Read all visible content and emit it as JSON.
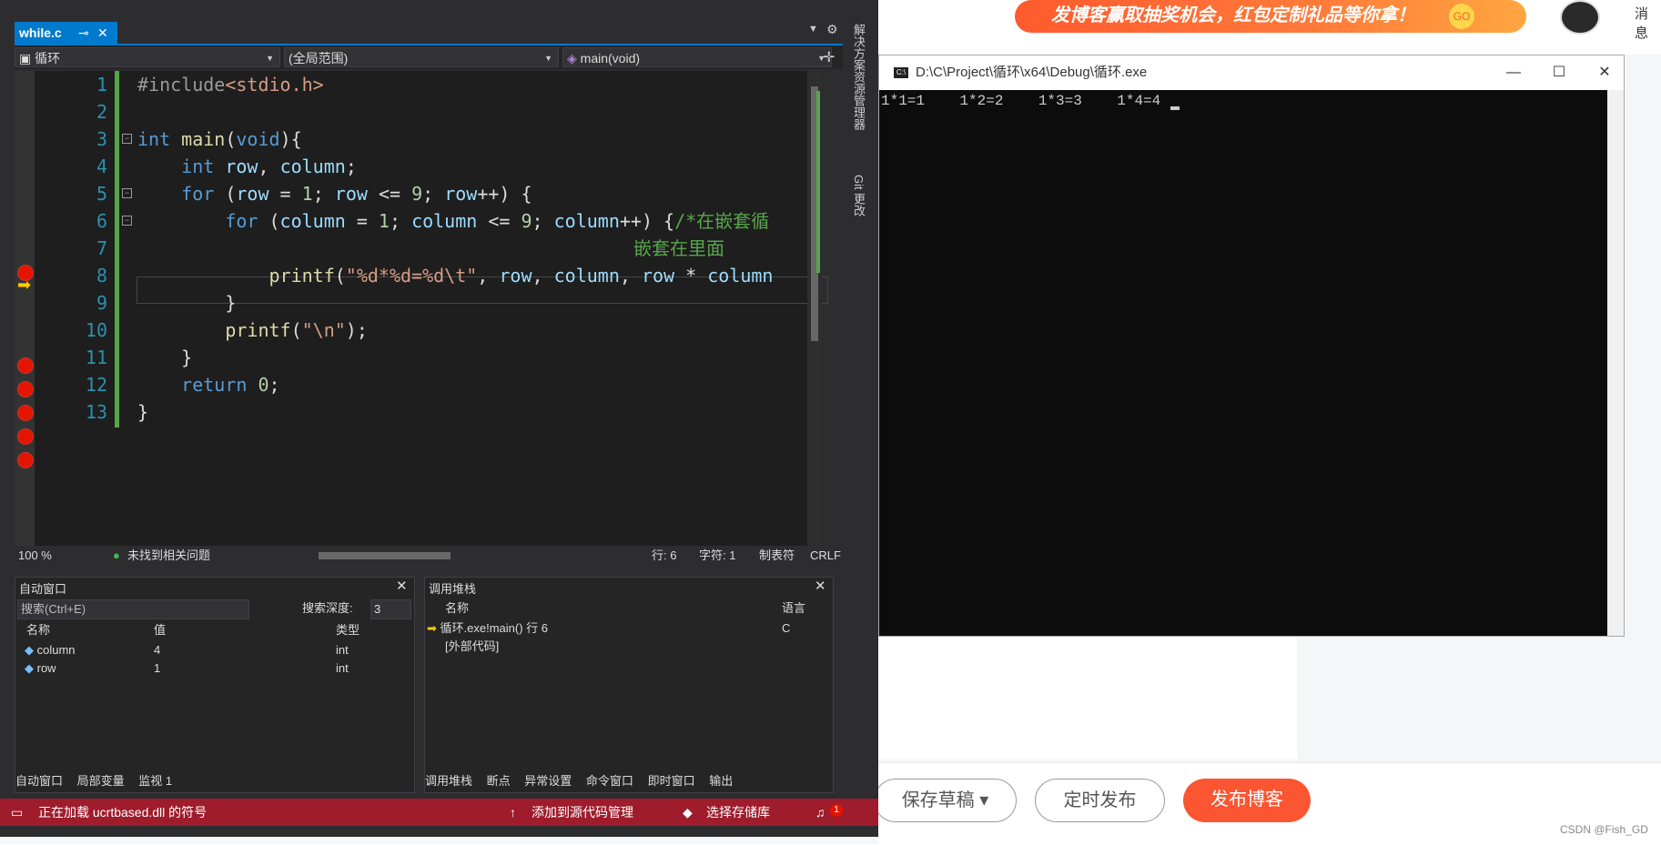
{
  "editor": {
    "file_tab": "while.c",
    "nav_file": "循环",
    "nav_scope": "(全局范围)",
    "nav_func": "main(void)",
    "line_numbers": [
      "1",
      "2",
      "3",
      "4",
      "5",
      "6",
      "7",
      "8",
      "9",
      "10",
      "11",
      "12",
      "13"
    ],
    "comment_tail_1": "/*在嵌套循",
    "comment_tail_2": "嵌套在里面",
    "zoom": "100 %",
    "issues": "未找到相关问题",
    "line_info": "行: 6",
    "char_info": "字符: 1",
    "tab_mode": "制表符",
    "eol": "CRLF"
  },
  "side_panels": [
    "解决方案资源管理器",
    "Git 更改"
  ],
  "autos": {
    "title": "自动窗口",
    "search_placeholder": "搜索(Ctrl+E)",
    "depth_label": "搜索深度:",
    "depth_value": "3",
    "columns": [
      "名称",
      "值",
      "类型"
    ],
    "rows": [
      {
        "name": "column",
        "value": "4",
        "type": "int"
      },
      {
        "name": "row",
        "value": "1",
        "type": "int"
      }
    ],
    "tabs": [
      "自动窗口",
      "局部变量",
      "监视 1"
    ]
  },
  "callstack": {
    "title": "调用堆栈",
    "columns": [
      "名称",
      "语言"
    ],
    "rows": [
      {
        "name": "循环.exe!main() 行 6",
        "lang": "C"
      },
      {
        "name": "[外部代码]",
        "lang": ""
      }
    ],
    "tabs": [
      "调用堆栈",
      "断点",
      "异常设置",
      "命令窗口",
      "即时窗口",
      "输出"
    ]
  },
  "statusbar": {
    "message": "正在加载 ucrtbased.dll 的符号",
    "source_control": "添加到源代码管理",
    "repo": "选择存储库",
    "notif_count": "1"
  },
  "console": {
    "title": "D:\\C\\Project\\循环\\x64\\Debug\\循环.exe",
    "output": "1*1=1    1*2=2    1*3=3    1*4=4",
    "icon": "console-icon"
  },
  "blog": {
    "promo": "发博客赢取抽奖机会，红包定制礼品等你拿！",
    "promo_go": "GO",
    "msg": "消息",
    "draft_label": "保存草稿 ▾",
    "timed_label": "定时发布",
    "publish_label": "发布博客",
    "watermark": "CSDN @Fish_GD"
  },
  "colors": {
    "accent": "#007acc",
    "statusbar": "#9e1c2c",
    "publish": "#fc5531",
    "breakpoint": "#e51400"
  }
}
